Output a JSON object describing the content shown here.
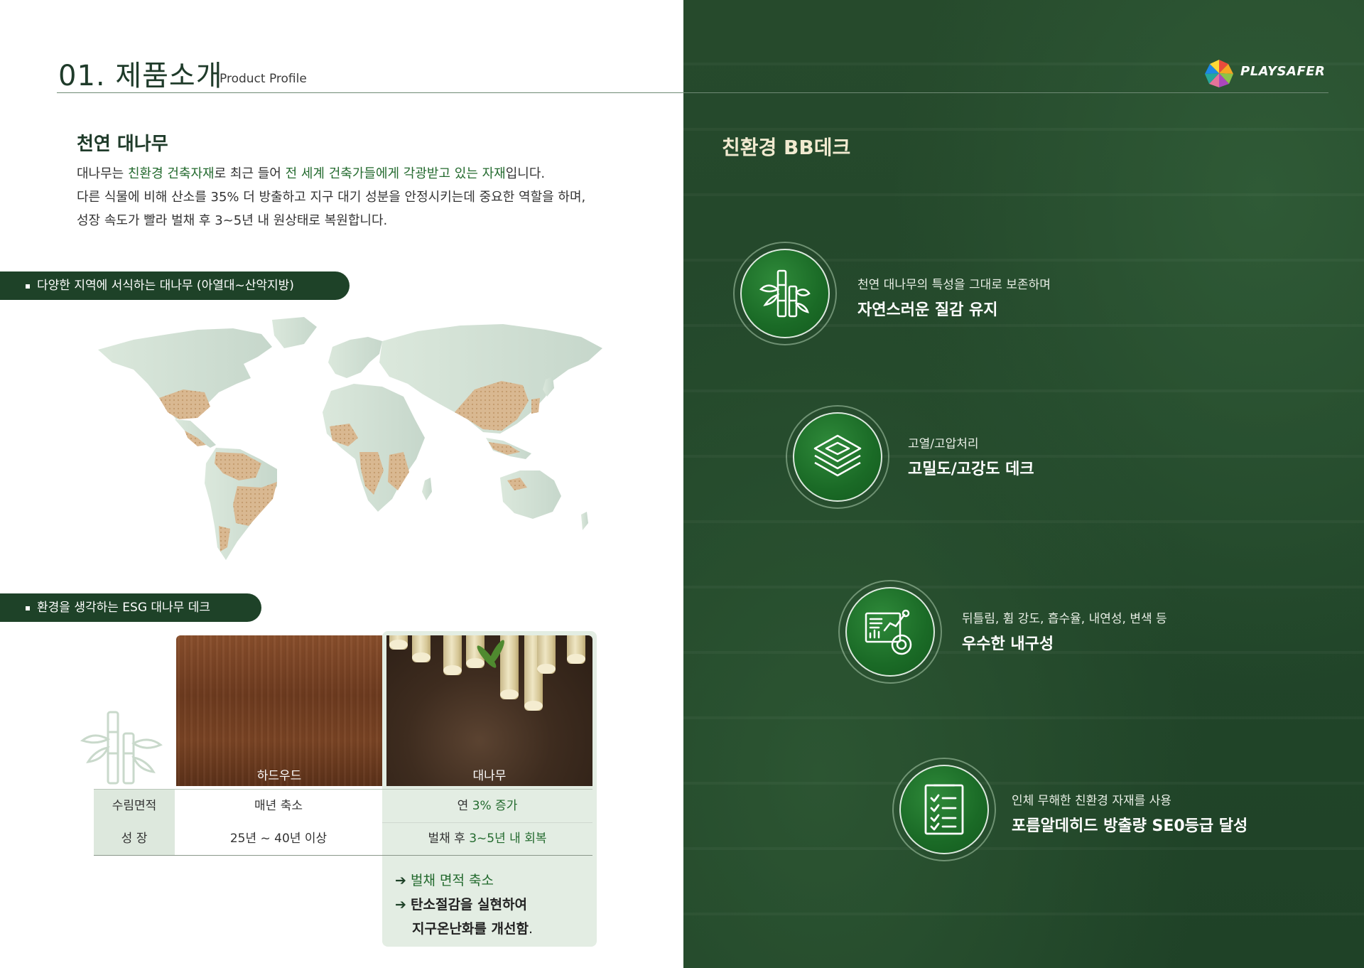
{
  "header": {
    "title": "01. 제품소개",
    "subtitle": "Product Profile"
  },
  "intro": {
    "heading": "천연 대나무",
    "line1": {
      "a": "대나무는 ",
      "b": "친환경 건축자재",
      "c": "로 최근 들어 ",
      "d": "전 세계 건축가들에게 각광받고 있는 자재",
      "e": "입니다."
    },
    "line2": "다른 식물에 비해 산소를 35% 더 방출하고 지구 대기 성분을 안정시키는데 중요한 역할을 하며,",
    "line3": "성장 속도가 빨라 벌채 후 3~5년 내 원상태로 복원합니다."
  },
  "section_map": {
    "label": "다양한 지역에 서식하는 대나무 (아열대~산악지방)"
  },
  "section_esg": {
    "label": "환경을 생각하는 ESG 대나무 데크"
  },
  "comparison": {
    "col1": "하드우드",
    "col2": "대나무",
    "rows": [
      {
        "header": "수림면적",
        "v1": "매년 축소",
        "v2a": "연 ",
        "v2b": "3% 증가"
      },
      {
        "header": "성 장",
        "v1": "25년 ~ 40년 이상",
        "v2a": "벌채 후 ",
        "v2b": "3~5년 내 회복"
      }
    ],
    "result": {
      "line1": "벌채 면적 축소",
      "line2": "탄소절감을 실현하여",
      "line3": "지구온난화를 개선함",
      "line3_end": "."
    }
  },
  "right": {
    "title": "친환경 BB데크",
    "brand": "PLAYSAFER",
    "features": [
      {
        "small": "천연 대나무의 특성을 그대로 보존하며",
        "big": "자연스러운 질감 유지",
        "icon": "bamboo-icon"
      },
      {
        "small": "고열/고압처리",
        "big": "고밀도/고강도 데크",
        "icon": "layers-icon"
      },
      {
        "small": "뒤틀림, 휨 강도, 흡수율, 내연성, 변색 등",
        "big": "우수한 내구성",
        "icon": "analytics-icon"
      },
      {
        "small": "인체 무해한 친환경 자재를 사용",
        "big": "포름알데히드 방출량 SE0등급 달성",
        "icon": "checklist-icon"
      }
    ]
  },
  "colors": {
    "dark_green": "#1e4228",
    "accent_green": "#236a2e",
    "cream": "#f1ead0",
    "map_land": "#d3e2d6",
    "bamboo_region": "#d9b891"
  }
}
